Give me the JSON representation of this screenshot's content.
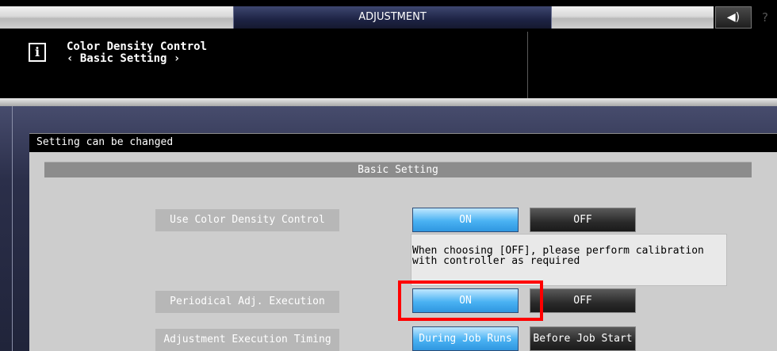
{
  "topbar": {
    "title": "ADJUSTMENT",
    "sound_icon": "speaker-icon",
    "sound_glyph": "◀)",
    "help_glyph": "?"
  },
  "header": {
    "info_icon": "info-icon",
    "info_glyph": "i",
    "title": "Color Density Control",
    "subtitle": "‹ Basic Setting ›"
  },
  "status": {
    "text": "Setting can be changed"
  },
  "section": {
    "title": "Basic Setting"
  },
  "settings": {
    "color_density": {
      "label": "Use Color Density Control",
      "on": "ON",
      "off": "OFF",
      "selected": "ON",
      "note": "When choosing [OFF], please perform calibration\nwith controller as required"
    },
    "periodical": {
      "label": "Periodical Adj. Execution",
      "on": "ON",
      "off": "OFF",
      "selected": "ON"
    },
    "timing": {
      "label": "Adjustment Execution Timing",
      "during": "During Job Runs",
      "before": "Before Job Start",
      "selected": "During Job Runs"
    }
  },
  "colors": {
    "selected_button": "#4ab2f3",
    "unselected_button": "#2a2a2a",
    "highlight": "#ff0000",
    "content_bg": "#cdcdcd"
  }
}
